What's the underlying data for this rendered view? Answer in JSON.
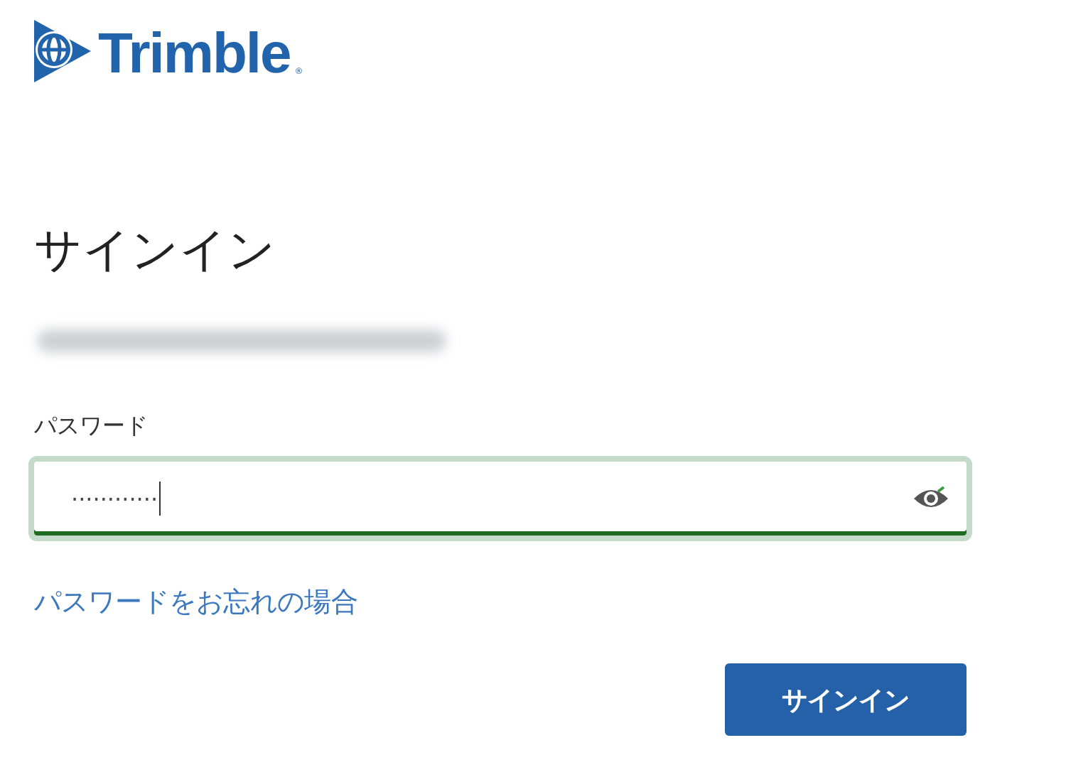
{
  "logo": {
    "text": "Trimble",
    "mark": "®"
  },
  "heading": "サインイン",
  "account": {
    "kind": "redacted"
  },
  "password": {
    "label": "パスワード",
    "value": "············",
    "focused": true
  },
  "forgot_link": "パスワードをお忘れの場合",
  "buttons": [
    "サインイン"
  ]
}
